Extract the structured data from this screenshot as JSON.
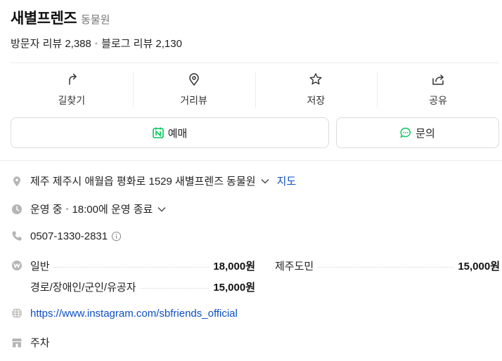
{
  "header": {
    "name": "새별프렌즈",
    "category": "동물원"
  },
  "reviews": {
    "visitor": "방문자 리뷰 2,388",
    "blog": "블로그 리뷰 2,130"
  },
  "actions": [
    {
      "label": "길찾기",
      "icon": "directions-icon"
    },
    {
      "label": "거리뷰",
      "icon": "location-pin-icon"
    },
    {
      "label": "저장",
      "icon": "star-icon"
    },
    {
      "label": "공유",
      "icon": "share-icon"
    }
  ],
  "buttons": {
    "reserve": "예매",
    "inquiry": "문의"
  },
  "info": {
    "address": "제주 제주시 애월읍 평화로 1529 새별프렌즈 동물원",
    "map_link": "지도",
    "status": "운영 중",
    "hours": "18:00에 운영 종료",
    "phone": "0507-1330-2831",
    "website": "https://www.instagram.com/sbfriends_official",
    "parking": "주차"
  },
  "prices": [
    {
      "name": "일반",
      "value": "18,000원"
    },
    {
      "name": "제주도민",
      "value": "15,000원"
    },
    {
      "name": "경로/장애인/군인/유공자",
      "value": "15,000원"
    }
  ],
  "colors": {
    "naver_green": "#03c75a",
    "link_blue": "#0b4fc4",
    "icon_gray": "#b5b5b5"
  }
}
